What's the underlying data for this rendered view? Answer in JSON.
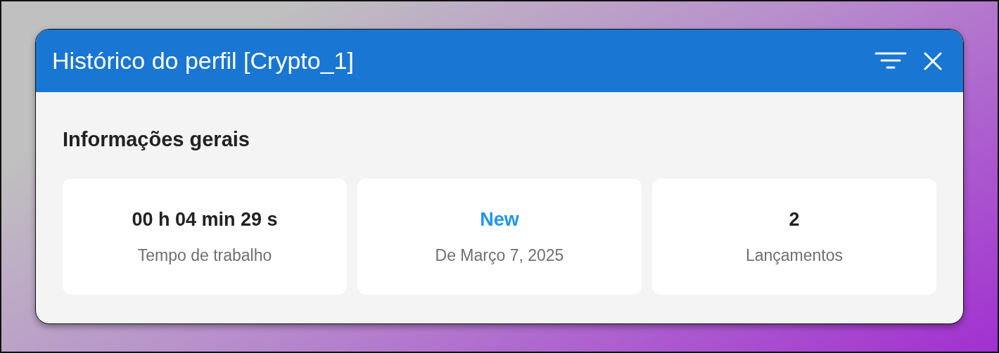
{
  "window": {
    "title": "Histórico do perfil [Crypto_1]"
  },
  "section": {
    "title": "Informações gerais"
  },
  "cards": [
    {
      "value": "00 h 04 min 29 s",
      "label": "Tempo de trabalho",
      "color": "#222222"
    },
    {
      "value": "New",
      "label": "De Março 7, 2025",
      "color": "#2196f3"
    },
    {
      "value": "2",
      "label": "Lançamentos",
      "color": "#222222"
    }
  ]
}
